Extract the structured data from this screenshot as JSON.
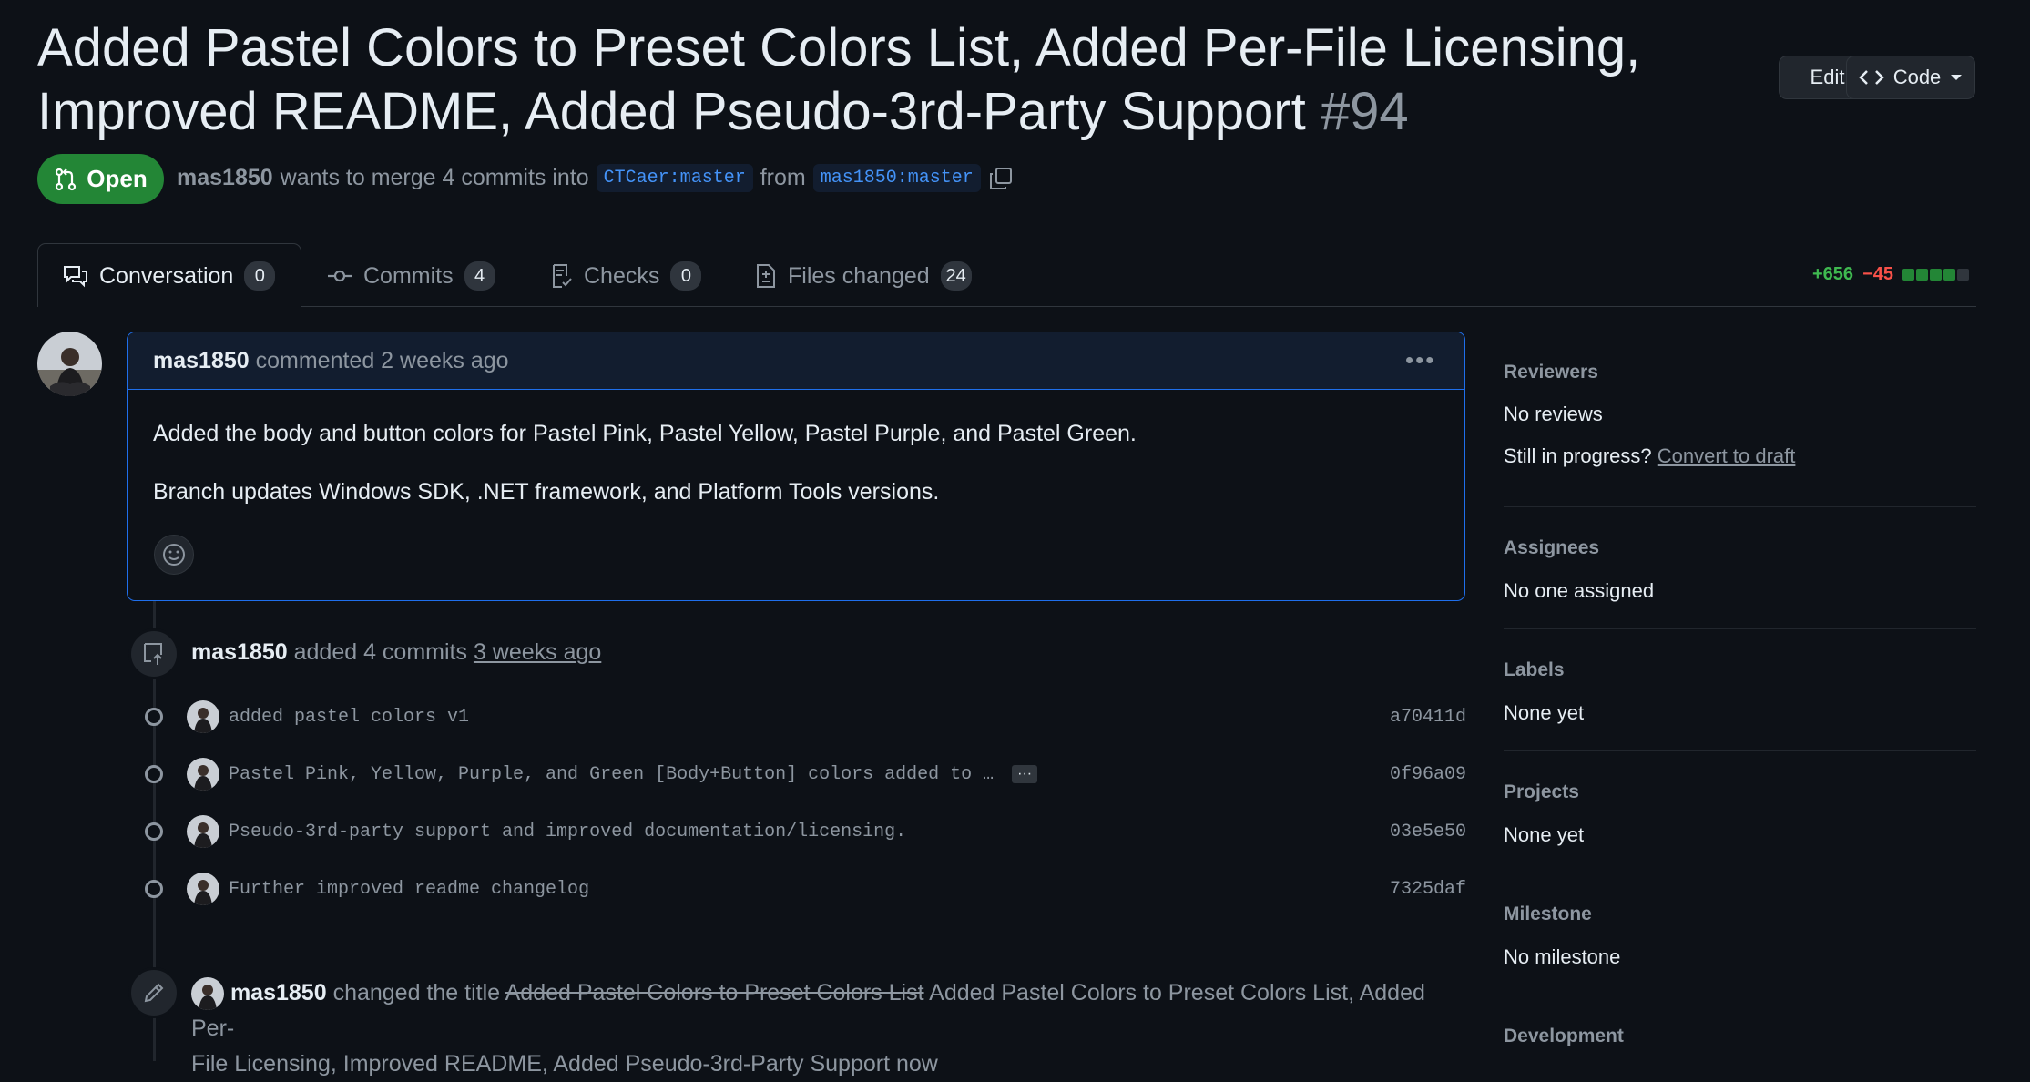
{
  "header": {
    "title": "Added Pastel Colors to Preset Colors List, Added Per-File Licensing, Improved README, Added Pseudo-3rd-Party Support",
    "number": "#94",
    "edit_label": "Edit",
    "code_label": "Code"
  },
  "status": {
    "state": "Open",
    "author": "mas1850",
    "merge_text": "wants to merge 4 commits into",
    "base_branch": "CTCaer:master",
    "from_text": "from",
    "head_branch": "mas1850:master"
  },
  "tabs": [
    {
      "label": "Conversation",
      "count": "0",
      "icon": "comment-discussion-icon"
    },
    {
      "label": "Commits",
      "count": "4",
      "icon": "git-commit-icon"
    },
    {
      "label": "Checks",
      "count": "0",
      "icon": "checklist-icon"
    },
    {
      "label": "Files changed",
      "count": "24",
      "icon": "file-diff-icon"
    }
  ],
  "diffstat": {
    "additions": "+656",
    "deletions": "−45"
  },
  "comment": {
    "author": "mas1850",
    "meta": "commented 2 weeks ago",
    "paragraphs": [
      "Added the body and button colors for Pastel Pink, Pastel Yellow, Pastel Purple, and Pastel Green.",
      "Branch updates Windows SDK, .NET framework, and Platform Tools versions."
    ]
  },
  "commits_event": {
    "author": "mas1850",
    "action": "added 4 commits",
    "time": "3 weeks ago",
    "commits": [
      {
        "message": "added pastel colors v1",
        "sha": "a70411d"
      },
      {
        "message": "Pastel Pink, Yellow, Purple, and Green [Body+Button] colors added to …",
        "sha": "0f96a09",
        "more": "···"
      },
      {
        "message": "Pseudo-3rd-party support and improved documentation/licensing.",
        "sha": "03e5e50"
      },
      {
        "message": "Further improved readme changelog",
        "sha": "7325daf"
      }
    ]
  },
  "title_event": {
    "author": "mas1850",
    "action": "changed the title",
    "old_title": "Added Pastel Colors to Preset Colors List",
    "new_title_line1": "Added Pastel Colors to Preset Colors List, Added Per-",
    "new_title_line2": "File Licensing, Improved README, Added Pseudo-3rd-Party Support",
    "time": "now"
  },
  "sidebar": {
    "reviewers": {
      "heading": "Reviewers",
      "value": "No reviews",
      "progress_q": "Still in progress?",
      "draft_link": "Convert to draft"
    },
    "assignees": {
      "heading": "Assignees",
      "value": "No one assigned"
    },
    "labels": {
      "heading": "Labels",
      "value": "None yet"
    },
    "projects": {
      "heading": "Projects",
      "value": "None yet"
    },
    "milestone": {
      "heading": "Milestone",
      "value": "No milestone"
    },
    "development": {
      "heading": "Development"
    }
  },
  "colors": {
    "accent": "#1f6feb",
    "open_green": "#238636",
    "add": "#3fb950",
    "del": "#f85149"
  }
}
